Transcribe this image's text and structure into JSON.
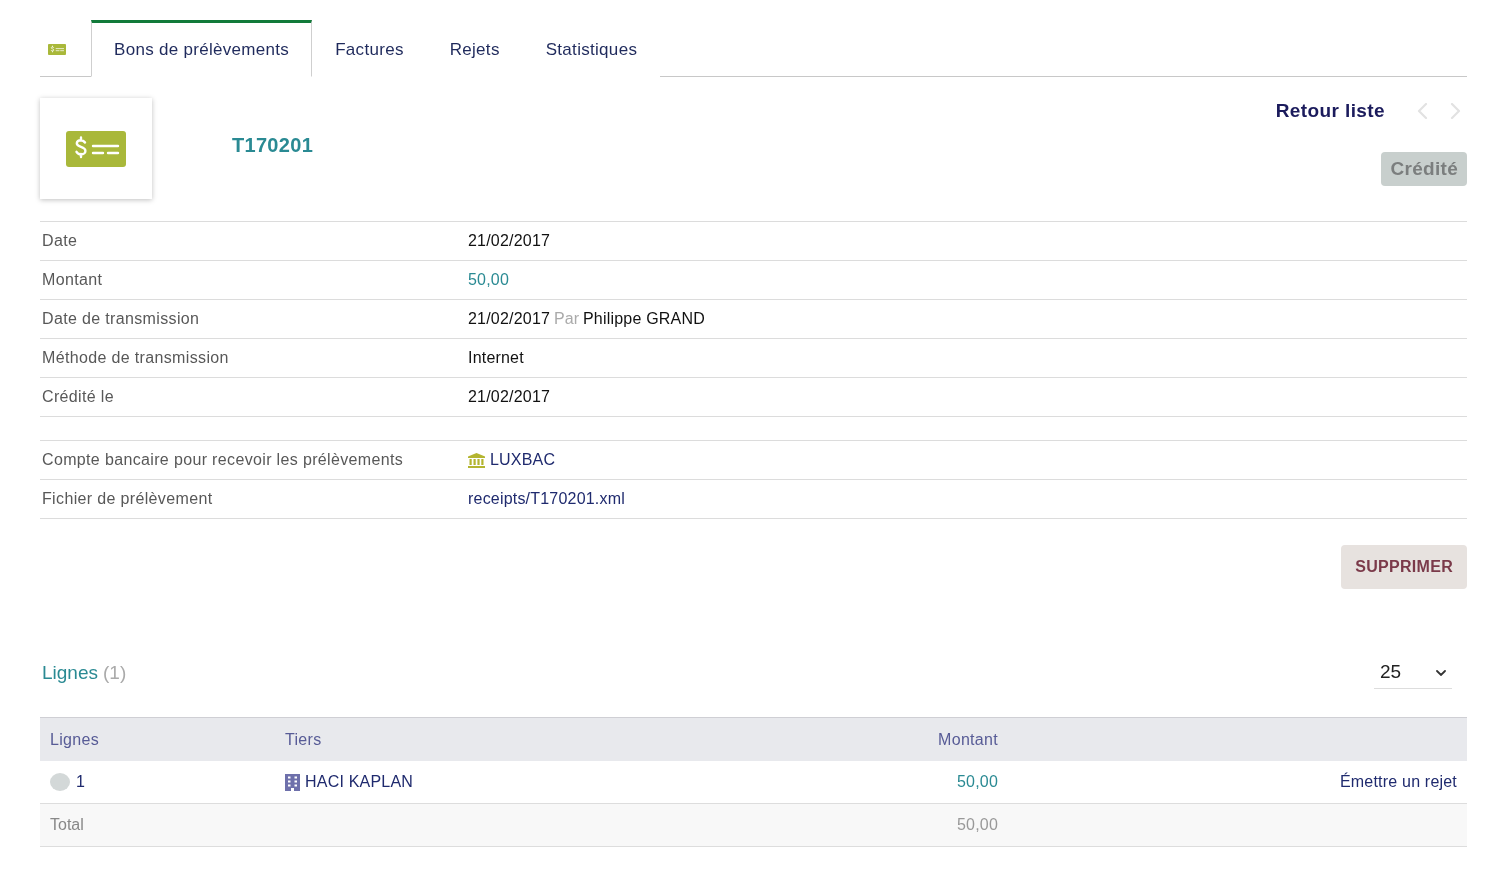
{
  "tabs": [
    {
      "label": "Bons de prélèvements",
      "selected": true
    },
    {
      "label": "Factures",
      "selected": false
    },
    {
      "label": "Rejets",
      "selected": false
    },
    {
      "label": "Statistiques",
      "selected": false
    }
  ],
  "header": {
    "reference": "T170201",
    "back_link": "Retour liste",
    "previous": {
      "disabled": true
    },
    "next": {
      "disabled": true
    },
    "status": "Crédité"
  },
  "fields": [
    {
      "kind": "text",
      "label": "Date",
      "value": "21/02/2017"
    },
    {
      "kind": "amount",
      "label": "Montant",
      "value": "50,00"
    },
    {
      "kind": "transmission",
      "label": "Date de transmission",
      "value": "21/02/2017",
      "by_label": "Par",
      "by_name": "Philippe GRAND"
    },
    {
      "kind": "text",
      "label": "Méthode de transmission",
      "value": "Internet"
    },
    {
      "kind": "text",
      "label": "Crédité le",
      "value": "21/02/2017"
    }
  ],
  "account_fields": [
    {
      "kind": "bank",
      "label": "Compte bancaire pour recevoir les prélèvements",
      "value": "LUXBAC"
    },
    {
      "kind": "file",
      "label": "Fichier de prélèvement",
      "value": "receipts/T170201.xml"
    }
  ],
  "delete_button": "SUPPRIMER",
  "lines": {
    "title": "Lignes",
    "count": "(1)",
    "page_size": "25",
    "columns": [
      "Lignes",
      "Tiers",
      "Montant"
    ],
    "rows": [
      {
        "number": "1",
        "color": "#d3d8d8",
        "third_party": "HACI KAPLAN",
        "amount": "50,00",
        "action": "Émettre un rejet"
      }
    ],
    "total": {
      "label": "Total",
      "amount": "50,00"
    }
  }
}
